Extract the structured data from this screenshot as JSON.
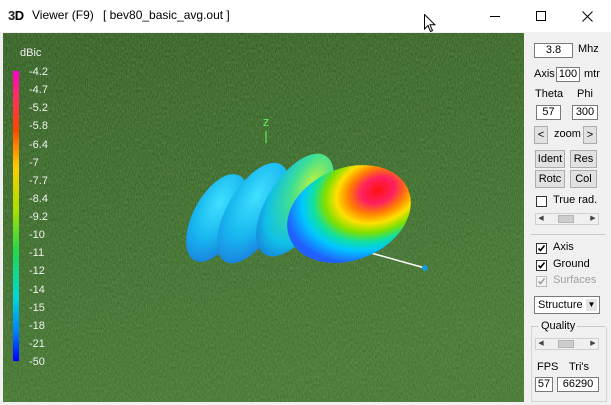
{
  "window": {
    "app_icon_3": "3",
    "app_icon_d": "D",
    "title": "Viewer (F9)",
    "file": "[  bev80_basic_avg.out ]"
  },
  "viewport": {
    "unit": "dBic",
    "scale": [
      "-4.2",
      "-4.7",
      "-5.2",
      "-5.8",
      "-6.4",
      "-7",
      "-7.7",
      "-8.4",
      "-9.2",
      "-10",
      "-11",
      "-12",
      "-14",
      "-15",
      "-18",
      "-21",
      "-50"
    ],
    "axis_label": "Z",
    "colors": {
      "ground": "#2c5a1c",
      "legend_text": "#f0f0f0",
      "axis_line": "#ffffff"
    }
  },
  "panel": {
    "freq_value": "3.8",
    "freq_unit": "Mhz",
    "axis_label": "Axis",
    "axis_value": "100",
    "axis_unit": "mtr",
    "theta_label": "Theta",
    "phi_label": "Phi",
    "theta_value": "57",
    "phi_value": "300",
    "zoom_left": "<",
    "zoom_label": "zoom",
    "zoom_right": ">",
    "ident_label": "Ident",
    "res_label": "Res",
    "rotc_label": "Rotc",
    "col_label": "Col",
    "true_rad_label": "True rad.",
    "axis_check_label": "Axis",
    "ground_label": "Ground",
    "surfaces_label": "Surfaces",
    "structure_value": "Structure",
    "quality_label": "Quality",
    "fps_label": "FPS",
    "tris_label": "Tri's",
    "fps_value": "57",
    "tris_value": "66290",
    "checks": {
      "true_rad": false,
      "axis": true,
      "ground": true,
      "surfaces": true
    },
    "quality_level": 0.45,
    "true_rad_slider_level": 0.45
  }
}
